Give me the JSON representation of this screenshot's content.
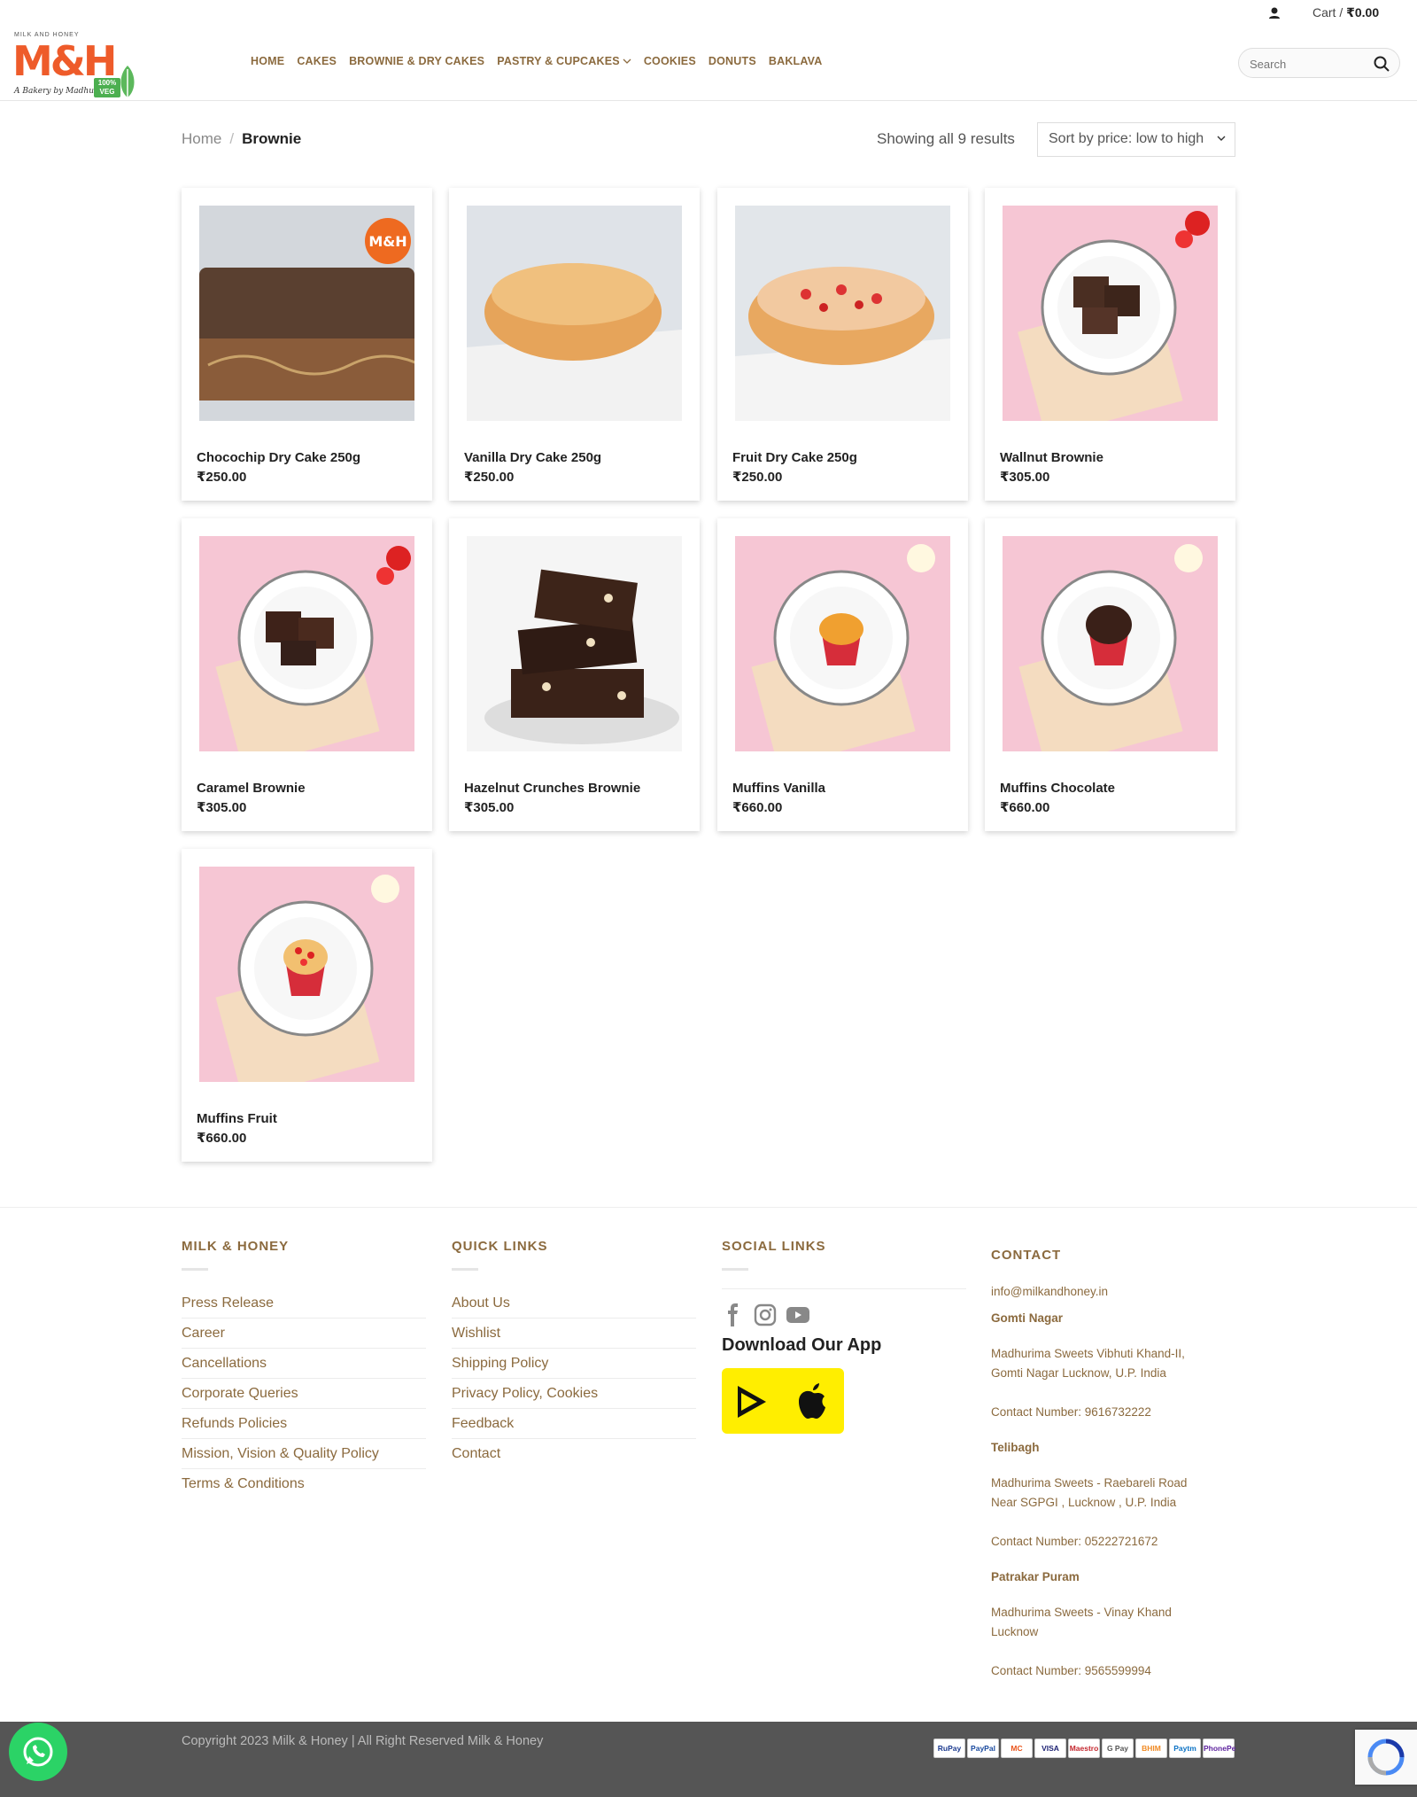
{
  "topbar": {
    "cart_label": "Cart /",
    "cart_total": "₹0.00"
  },
  "logo": {
    "small": "MILK AND HONEY",
    "main": "M&H",
    "tagline": "A Bakery by Madhurima",
    "veg": "100% VEG"
  },
  "nav": [
    {
      "label": "HOME"
    },
    {
      "label": "CAKES"
    },
    {
      "label": "BROWNIE & DRY CAKES"
    },
    {
      "label": "PASTRY & CUPCAKES",
      "dropdown": true
    },
    {
      "label": "COOKIES"
    },
    {
      "label": "DONUTS"
    },
    {
      "label": "BAKLAVA"
    }
  ],
  "search": {
    "placeholder": "Search"
  },
  "breadcrumb": {
    "home": "Home",
    "separator": "/",
    "current": "Brownie"
  },
  "results_text": "Showing all 9 results",
  "sort": {
    "selected": "Sort by price: low to high"
  },
  "products": [
    {
      "name": "Chocochip Dry Cake 250g",
      "price": "₹250.00",
      "image": "chocochip-dry-cake"
    },
    {
      "name": "Vanilla Dry Cake 250g",
      "price": "₹250.00",
      "image": "vanilla-dry-cake"
    },
    {
      "name": "Fruit Dry Cake 250g",
      "price": "₹250.00",
      "image": "fruit-dry-cake"
    },
    {
      "name": "Wallnut Brownie",
      "price": "₹305.00",
      "image": "walnut-brownie"
    },
    {
      "name": "Caramel Brownie",
      "price": "₹305.00",
      "image": "caramel-brownie"
    },
    {
      "name": "Hazelnut Crunches Brownie",
      "price": "₹305.00",
      "image": "hazelnut-brownie"
    },
    {
      "name": "Muffins Vanilla",
      "price": "₹660.00",
      "image": "muffin-vanilla"
    },
    {
      "name": "Muffins Chocolate",
      "price": "₹660.00",
      "image": "muffin-chocolate"
    },
    {
      "name": "Muffins Fruit",
      "price": "₹660.00",
      "image": "muffin-fruit"
    }
  ],
  "footer": {
    "col1": {
      "title": "MILK & HONEY",
      "links": [
        "Press Release",
        "Career",
        "Cancellations",
        "Corporate Queries",
        "Refunds Policies",
        "Mission, Vision & Quality Policy",
        "Terms & Conditions"
      ]
    },
    "col2": {
      "title": "QUICK LINKS",
      "links": [
        "About Us",
        "Wishlist",
        "Shipping Policy",
        "Privacy Policy, Cookies",
        "Feedback",
        "Contact"
      ]
    },
    "col3": {
      "title": "SOCIAL LINKS",
      "download": "Download Our App"
    },
    "col4": {
      "title": "CONTACT",
      "email": "info@milkandhoney.in",
      "locations": [
        {
          "name": "Gomti Nagar",
          "address1": "Madhurima Sweets Vibhuti Khand-II,",
          "address2": "Gomti Nagar Lucknow, U.P. India",
          "phone": "Contact Number: 9616732222"
        },
        {
          "name": "Telibagh",
          "address1": "Madhurima Sweets - Raebareli Road",
          "address2": "Near SGPGI , Lucknow , U.P. India",
          "phone": "Contact Number: 05222721672"
        },
        {
          "name": "Patrakar Puram",
          "address1": "Madhurima Sweets - Vinay Khand",
          "address2": "Lucknow",
          "phone": "Contact Number: 9565599994"
        }
      ]
    }
  },
  "bottom": {
    "copyright": "Copyright 2023 Milk & Honey | All Right Reserved Milk & Honey",
    "payments": [
      "RuPay",
      "PayPal",
      "MC",
      "VISA",
      "Maestro",
      "G Pay",
      "BHIM",
      "Paytm",
      "PhonePe"
    ]
  },
  "colors": {
    "accent": "#8b6a3e",
    "logo": "#ee5b2a",
    "app_badge": "#ffee00",
    "whatsapp": "#2bd366"
  }
}
